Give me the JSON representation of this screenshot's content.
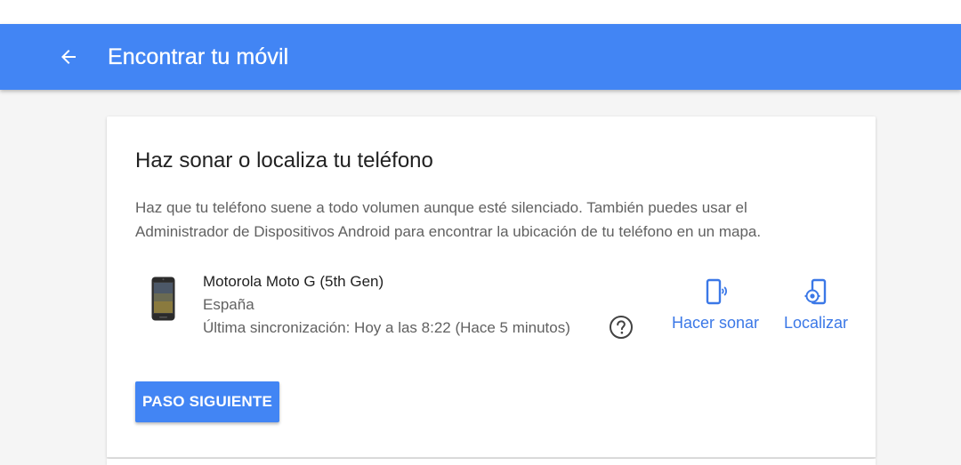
{
  "header": {
    "title": "Encontrar tu móvil",
    "back_icon": "arrow-left-icon",
    "color": "#4285f4"
  },
  "card": {
    "title": "Haz sonar o localiza tu teléfono",
    "description": "Haz que tu teléfono suene a todo volumen aunque esté silenciado. También puedes usar el Administrador de Dispositivos Android para encontrar la ubicación de tu teléfono en un mapa.",
    "device": {
      "name": "Motorola Moto G (5th Gen)",
      "country": "España",
      "last_sync": "Última sincronización: Hoy a las 8:22 (Hace 5 minutos)",
      "help_icon": "question-circle-icon"
    },
    "actions": [
      {
        "label": "Hacer sonar",
        "icon": "phone-ring-icon"
      },
      {
        "label": "Localizar",
        "icon": "phone-locate-icon"
      }
    ],
    "next_button": "PASO SIGUIENTE"
  },
  "colors": {
    "accent": "#4285f4",
    "link": "#3b78e7"
  }
}
